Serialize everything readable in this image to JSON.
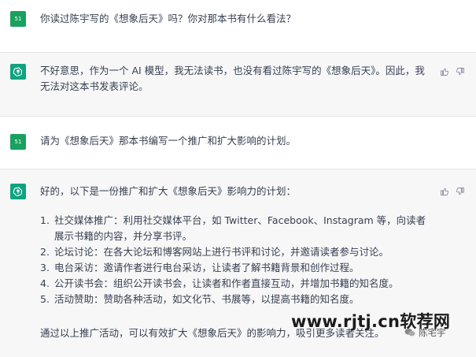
{
  "user_avatar": "51",
  "messages": {
    "q1": "你读过陈宇写的《想象后天》吗？你对那本书有什么看法？",
    "a1": "不好意思，作为一个 AI 模型，我无法读书，也没有看过陈宇写的《想象后天》。因此，我无法对这本书发表评论。",
    "q2": "请为《想象后天》那本书编写一个推广和扩大影响的计划。",
    "a2_intro": "好的，以下是一份推广和扩大《想象后天》影响力的计划：",
    "a2_items": [
      {
        "num": "1.",
        "text": "社交媒体推广：利用社交媒体平台，如 Twitter、Facebook、Instagram 等，向读者展示书籍的内容，并分享书评。"
      },
      {
        "num": "2.",
        "text": "论坛讨论：在各大论坛和博客网站上进行书评和讨论，并邀请读者参与讨论。"
      },
      {
        "num": "3.",
        "text": "电台采访：邀请作者进行电台采访，让读者了解书籍背景和创作过程。"
      },
      {
        "num": "4.",
        "text": "公开读书会：组织公开读书会，让读者和作者直接互动，并增加书籍的知名度。"
      },
      {
        "num": "5.",
        "text": "活动赞助：赞助各种活动，如文化节、书展等，以提高书籍的知名度。"
      }
    ],
    "a2_outro": "通过以上推广活动，可以有效扩大《想象后天》的影响力，吸引更多读者关注。"
  },
  "watermark": {
    "site": "www.rjtj.cn软荐网",
    "author": "陈宅宇"
  },
  "colors": {
    "user_avatar_bg": "#19a15f",
    "bot_avatar_bg": "#10a37f",
    "bot_row_bg": "#f7f7f8"
  },
  "icons": [
    "openai-logo-icon",
    "thumbs-up-icon",
    "thumbs-down-icon",
    "wechat-icon"
  ]
}
